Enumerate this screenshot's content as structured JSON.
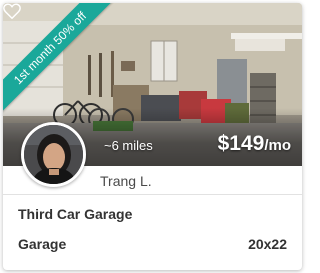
{
  "listing": {
    "promo": "1st month 50% off",
    "distance": "~6 miles",
    "price_amount": "$149",
    "price_unit": "/mo",
    "host_name": "Trang L.",
    "title": "Third Car Garage",
    "type": "Garage",
    "size": "20x22"
  },
  "icons": {
    "favorite": "heart-icon"
  },
  "colors": {
    "ribbon": "#1aa89a",
    "text": "#333333"
  }
}
